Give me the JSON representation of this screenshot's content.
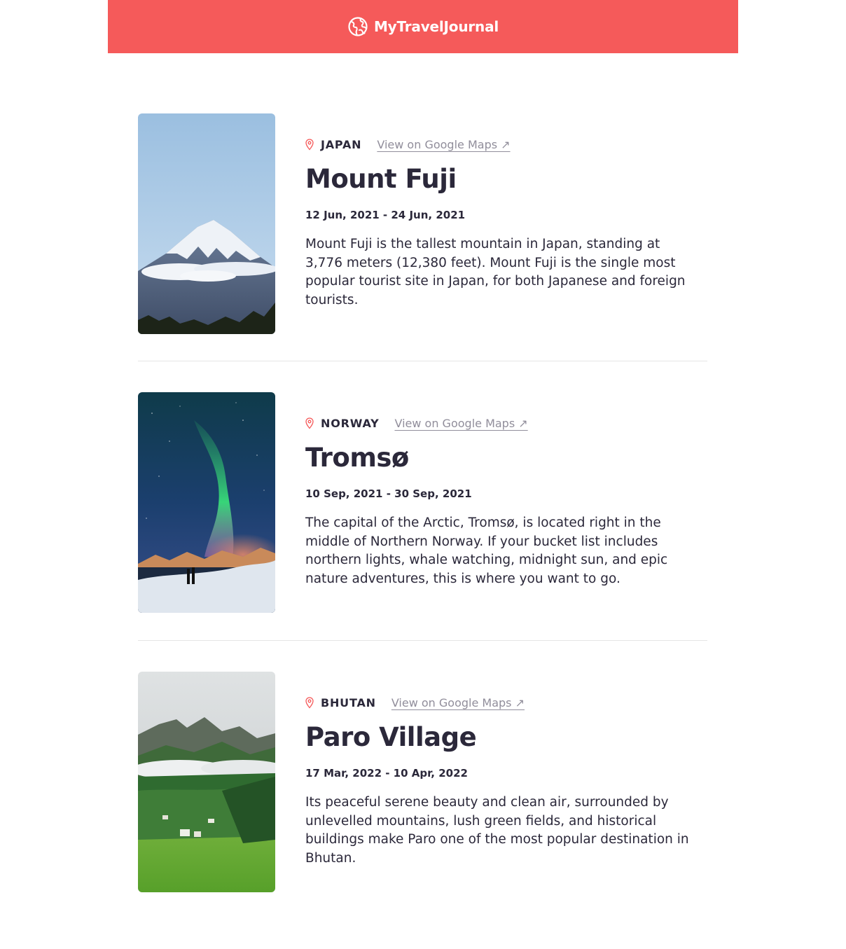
{
  "header": {
    "title": "MyTravelJournal",
    "background": "#f55a5a",
    "icon": "globe-icon"
  },
  "entries": [
    {
      "country": "JAPAN",
      "maps_link": "View on Google Maps ↗",
      "title": "Mount Fuji",
      "dates": "12 Jun, 2021 - 24 Jun, 2021",
      "description": "Mount Fuji is the tallest mountain in Japan, standing at 3,776 meters (12,380 feet). Mount Fuji is the single most popular tourist site in Japan, for both Japanese and foreign tourists."
    },
    {
      "country": "NORWAY",
      "maps_link": "View on Google Maps ↗",
      "title": "Tromsø",
      "dates": "10 Sep, 2021 - 30 Sep, 2021",
      "description": "The capital of the Arctic, Tromsø, is located right in the middle of Northern Norway. If your bucket list includes northern lights, whale watching, midnight sun, and epic nature adventures, this is where you want to go."
    },
    {
      "country": "BHUTAN",
      "maps_link": "View on Google Maps ↗",
      "title": "Paro Village",
      "dates": "17 Mar, 2022 - 10 Apr, 2022",
      "description": "Its peaceful serene beauty and clean air, surrounded by unlevelled mountains, lush green fields, and historical buildings make Paro one of the most popular destination in Bhutan."
    }
  ],
  "colors": {
    "accent": "#f55a5a",
    "heading": "#2b283a",
    "link": "#918e9b",
    "divider": "#e5e5e5"
  }
}
